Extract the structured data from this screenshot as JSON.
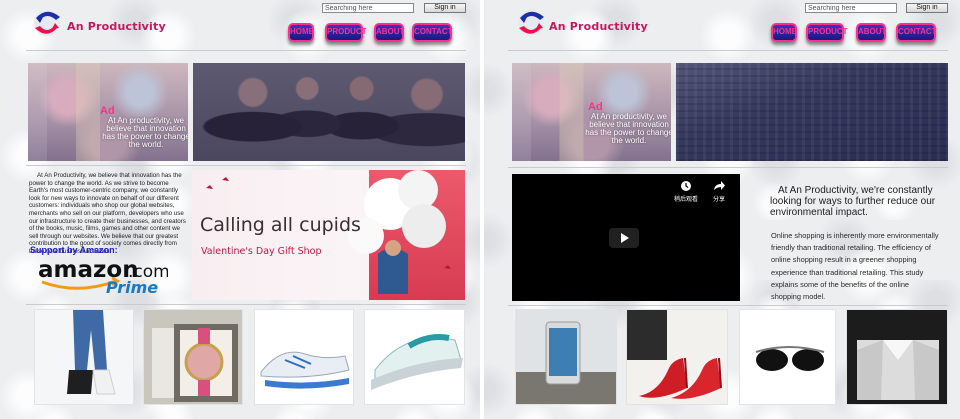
{
  "brand": {
    "name": "An Productivity"
  },
  "header": {
    "search_placeholder": "Searching here",
    "signin_label": "Sign in",
    "nav": [
      "HOME",
      "PRODUCT",
      "ABOUT",
      "CONTACT"
    ]
  },
  "colors": {
    "accent": "#ff2f8e",
    "nav_bg": "#2b21a0",
    "brand_text": "#c8175f",
    "support_text": "#2020cc"
  },
  "hero": {
    "title": "Ad",
    "text": "At An productivity, we believe that innovation has the power to change the world."
  },
  "about": {
    "text": "At An Productivity, we believe that innovation has the power to change the world. As we strive to become Earth's most customer-centric company, we constantly look for new ways to innovate on behalf of our different customers: individuals who shop our global websites, merchants who sell on our platform, developers who use our infrastructure to create their businesses, and creators of the books, music, films, games and other content we sell through our websites. We believe that our greatest contribution to the good of society comes directly from these core business activities.",
    "support_label": "Support by Amazon:"
  },
  "amazon_logo": {
    "word": "amazon",
    "suffix": ".com",
    "tag": "Prime"
  },
  "banner": {
    "title": "Calling all cupids",
    "subtitle": "Valentine's Day Gift Shop"
  },
  "video": {
    "watch_later": "稍后观看",
    "share": "分享"
  },
  "article": {
    "title": "At An Productivity, we're constantly looking for ways to further reduce our environmental impact.",
    "body": "Online shopping is inherently more environmentally friendly than traditional retailing. The efficiency of online shopping result in a greener shopping experience than traditional retailing. This study explains some of the benefits of the online shopping model."
  },
  "products_left": [
    "jeans",
    "watch",
    "sneakers",
    "iron"
  ],
  "products_right": [
    "smartphone",
    "red-heels",
    "sunglasses",
    "dress-shirt"
  ],
  "icons": [
    "brand-logo-icon",
    "play-icon",
    "clock-icon",
    "share-icon"
  ]
}
